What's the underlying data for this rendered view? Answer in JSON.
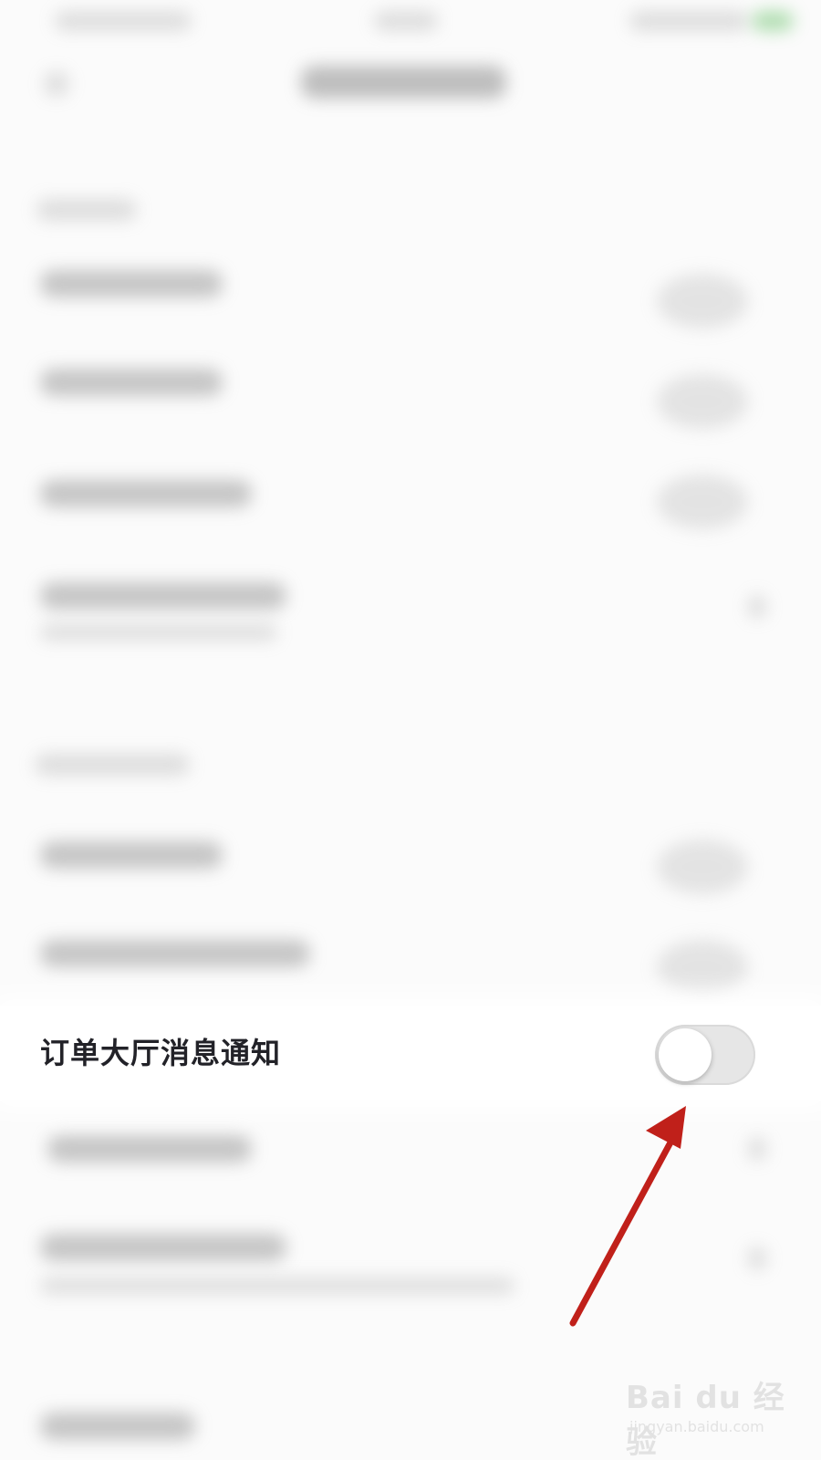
{
  "settings_row": {
    "label": "订单大厅消息通知",
    "toggle_state": "off"
  },
  "watermark": {
    "logo": "Bai du 经验",
    "url": "jingyan.baidu.com"
  },
  "colors": {
    "arrow": "#c0201a",
    "toggle_track": "#e6e6e6",
    "label_text": "#222228"
  }
}
